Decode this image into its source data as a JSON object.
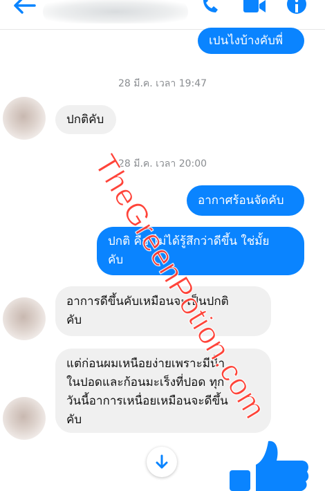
{
  "colors": {
    "accent": "#0a84ff",
    "incoming_bubble": "#f0f0f0",
    "watermark": "#ff3b30"
  },
  "header": {
    "back_icon": "arrow-left-icon",
    "phone_icon": "phone-icon",
    "video_icon": "video-camera-icon",
    "info_icon": "info-icon"
  },
  "messages": [
    {
      "text": "เปนไงบ้างคับพี่"
    },
    {
      "text": "ปกติคับ"
    },
    {
      "text": "อากาศร้อนจัดคับ"
    },
    {
      "text_line1": "ปกติ คือ ไม่ได้รู้สึกว่าดีขึ้น ใช่มั้ย",
      "text_line2": "คับ"
    },
    {
      "text_line1": "อาการดีขึ้นคับเหมือนจะเป็นปกติ",
      "text_line2": "คับ"
    },
    {
      "text_line1": "แต่ก่อนผมเหนือยง่ายเพราะมีน้ำ",
      "text_line2": "ในปอดและก้อนมะเร็งที่ปอด ทุก",
      "text_line3": "วันนี้อาการเหนื่อยเหมือนจะดีขึ้น",
      "text_line4": "คับ"
    }
  ],
  "timestamps": [
    "28 มี.ค. เวลา 19:47",
    "28 มี.ค. เวลา 20:00"
  ],
  "watermark": "TheGreenPotion.com",
  "scroll_down_icon": "arrow-down-icon",
  "like_icon": "thumbs-up-icon"
}
